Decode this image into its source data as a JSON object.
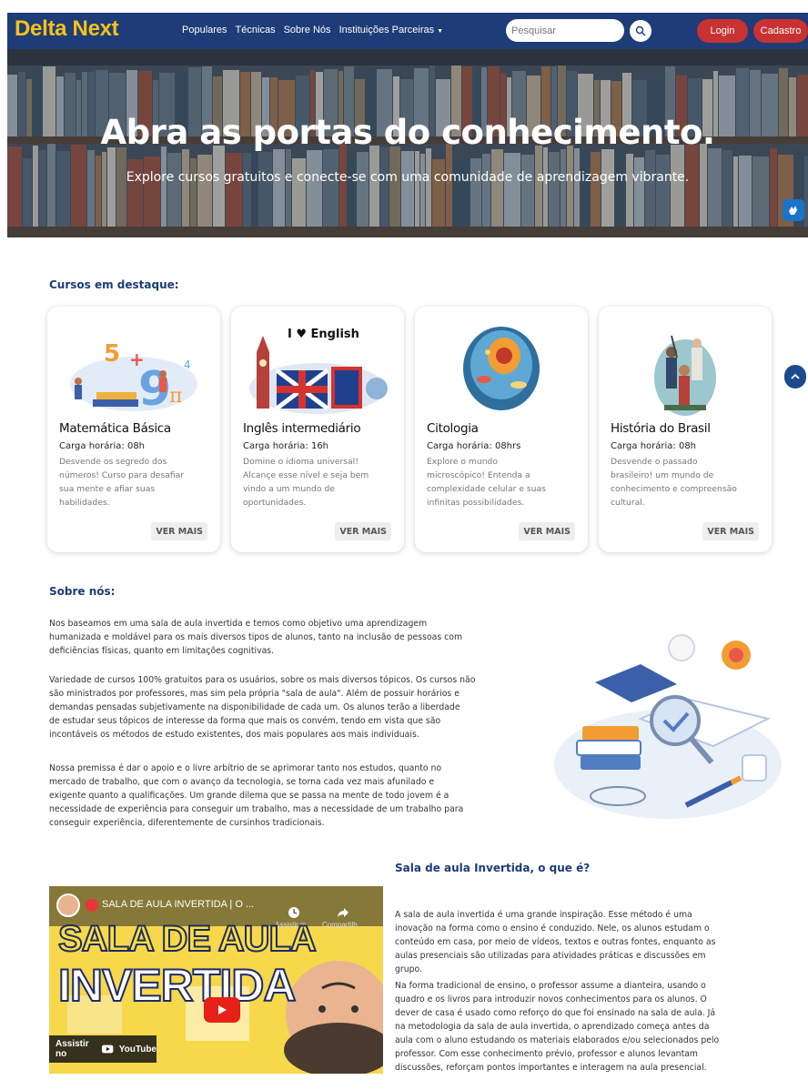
{
  "navbar": {
    "logo": "Delta Next",
    "links": [
      "Populares",
      "Técnicas",
      "Sobre Nós",
      "Instituições Parceiras"
    ],
    "search_placeholder": "Pesquisar",
    "login": "Login",
    "register": "Cadastro",
    "bg_color": "#1d3c78",
    "logo_color": "#f7c21a",
    "button_color": "#c83232"
  },
  "hero": {
    "title": "Abra as portas do conhecimento.",
    "subtitle": "Explore cursos gratuitos e conecte-se com uma comunidade de aprendizagem vibrante."
  },
  "featured": {
    "heading": "Cursos em destaque:",
    "cards": [
      {
        "title": "Matemática Básica",
        "hours": "Carga horária: 08h",
        "desc_lines": [
          "Desvende os segredo dos",
          "números! Curso para desafiar",
          "sua mente e afiar suas",
          "habilidades."
        ],
        "button": "VER MAIS"
      },
      {
        "title": "Inglês intermediário",
        "hours": "Carga horária: 16h",
        "desc_lines": [
          "Domine o idioma universal!",
          "Alcançe esse nível e seja bem",
          "vindo a um mundo de",
          "oportunidades."
        ],
        "button": "VER MAIS",
        "image_text": "I ♥ English"
      },
      {
        "title": "Citologia",
        "hours": "Carga horária: 08hrs",
        "desc_lines": [
          "Explore o mundo",
          "microscópico! Entenda a",
          "complexidade celular e suas",
          "infinitas possibilidades."
        ],
        "button": "VER MAIS"
      },
      {
        "title": "História do Brasil",
        "hours": "Carga horária: 08h",
        "desc_lines": [
          "Desvende o passado",
          "brasileiro! um mundo de",
          "conhecimento e compreensão",
          "cultural."
        ],
        "button": "VER MAIS"
      }
    ]
  },
  "about": {
    "heading": "Sobre nós:",
    "paragraphs": [
      [
        "Nos baseamos em uma sala de aula invertida e temos como objetivo uma aprendizagem",
        "humanizada e moldável para os mais diversos tipos de alunos, tanto na inclusão de pessoas com",
        "deficiências físicas, quanto em limitações cognitivas."
      ],
      [
        "Variedade de cursos 100% gratuitos para os usuários, sobre os mais diversos tópicos. Os cursos não",
        "são ministrados por professores, mas sim pela própria \"sala de aula\". Além de possuir horários e",
        "demandas pensadas subjetivamente na disponibilidade de cada um. Os alunos terão a liberdade",
        "de estudar seus tópicos de interesse da forma que mais os convém, tendo em vista que são",
        "incontáveis os métodos de estudo existentes, dos mais populares aos mais individuais."
      ],
      [
        "Nossa premissa é dar o apoio e o livre arbítrio de se aprimorar tanto nos estudos, quanto no",
        "mercado de trabalho, que com o avanço da tecnologia, se torna cada vez mais afunilado e",
        "exigente quanto a qualificações. Um grande dilema que se passa na mente de todo jovem é a",
        "necessidade de experiência para conseguir um trabalho, mas a necessidade de um trabalho para",
        "conseguir experiência, diferentemente de cursinhos tradicionais."
      ]
    ]
  },
  "sala": {
    "heading": "Sala de aula Invertida, o que é?",
    "paragraphs": [
      [
        "A sala de aula invertida é uma grande inspiração. Esse método é uma",
        "inovação na forma como o ensino é conduzido. Nele, os alunos estudam o",
        "conteúdo em casa, por meio de vídeos, textos e outras fontes, enquanto as",
        "aulas presenciais são utilizadas para atividades práticas e discussões em",
        "grupo."
      ],
      [
        "Na forma tradicional de ensino, o professor assume a dianteira, usando o",
        "quadro e os livros para introduzir novos conhecimentos para os alunos. O",
        "dever de casa é usado como reforço do que foi ensinado na sala de aula. Já",
        "na metodologia da sala de aula invertida, o aprendizado começa antes da",
        "aula com o aluno estudando os materiais elaborados e/ou selecionados pelo",
        "professor. Com esse conhecimento prévio, professor e alunos levantam",
        "discussões, reforçam pontos importantes e interagem na aula presencial."
      ]
    ]
  },
  "video": {
    "title": "SALA DE AULA INVERTIDA | O ...",
    "big_line1": "SALA DE AULA",
    "big_line2": "INVERTIDA",
    "watch_later": "Assistir m...",
    "share": "Compartilh...",
    "watch_on": "Assistir no",
    "youtube": "YouTube"
  }
}
